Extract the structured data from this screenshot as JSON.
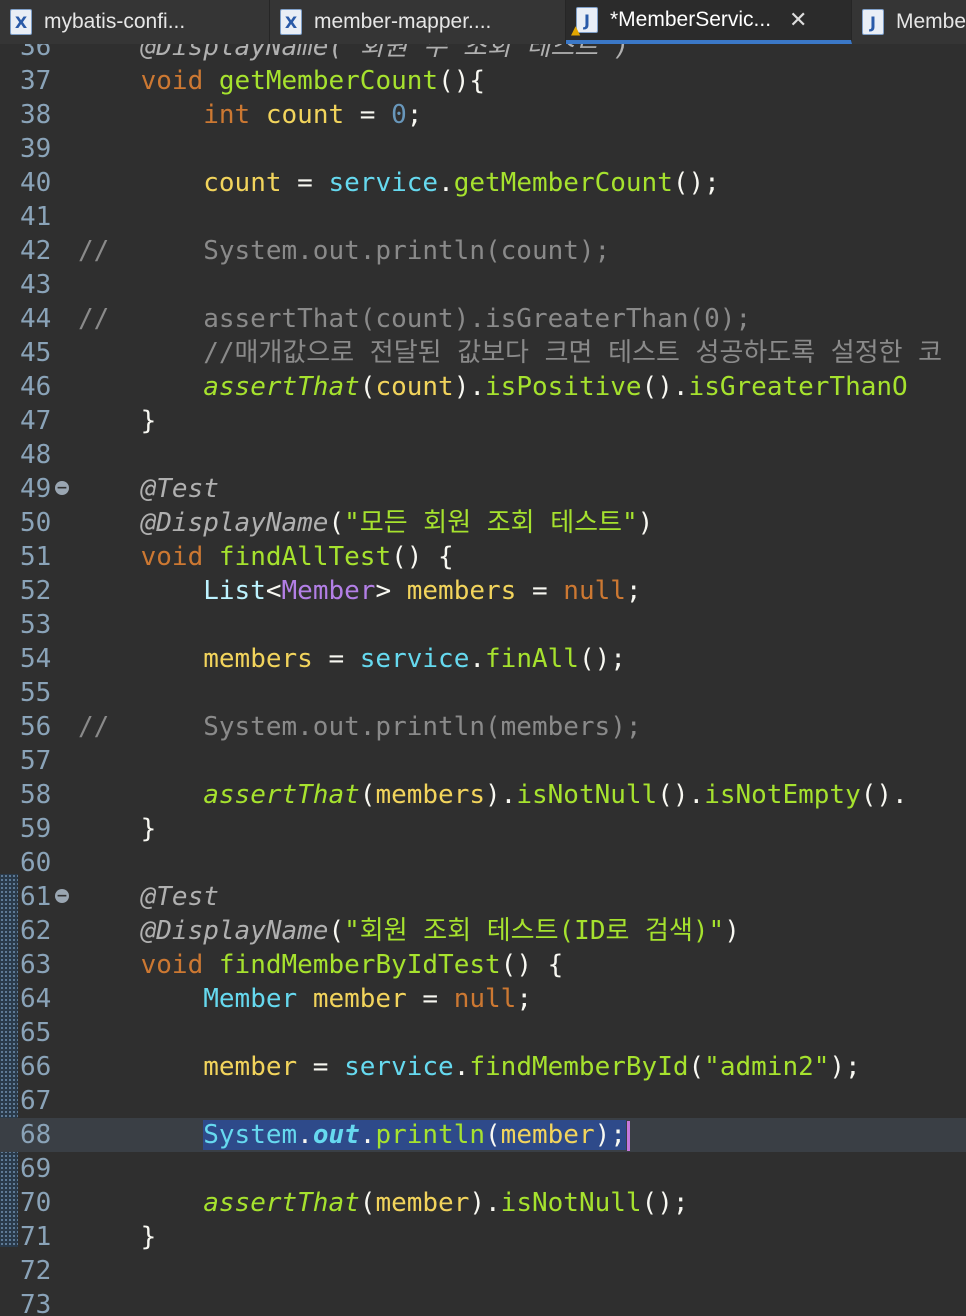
{
  "tabs": [
    {
      "label": "mybatis-confi...",
      "icon": "xml-file-icon",
      "active": false
    },
    {
      "label": "member-mapper....",
      "icon": "xml-file-icon",
      "active": false
    },
    {
      "label": "*MemberServic...",
      "icon": "java-file-warning-icon",
      "active": true
    },
    {
      "label": "Membe",
      "icon": "java-file-icon",
      "active": false
    }
  ],
  "editor": {
    "current_line": 68,
    "lines": [
      {
        "n": "36",
        "tokens": [
          {
            "t": "    ",
            "c": ""
          },
          {
            "t": "@DisplayName(\"회원 수 조회 테스트\")",
            "c": "ann"
          }
        ]
      },
      {
        "n": "37",
        "tokens": [
          {
            "t": "    ",
            "c": ""
          },
          {
            "t": "void",
            "c": "kw"
          },
          {
            "t": " ",
            "c": ""
          },
          {
            "t": "getMemberCount",
            "c": "method"
          },
          {
            "t": "(){",
            "c": "paren"
          }
        ]
      },
      {
        "n": "38",
        "tokens": [
          {
            "t": "        ",
            "c": ""
          },
          {
            "t": "int",
            "c": "kw"
          },
          {
            "t": " ",
            "c": ""
          },
          {
            "t": "count",
            "c": "var"
          },
          {
            "t": " = ",
            "c": "op"
          },
          {
            "t": "0",
            "c": "num"
          },
          {
            "t": ";",
            "c": "paren"
          }
        ]
      },
      {
        "n": "39",
        "tokens": []
      },
      {
        "n": "40",
        "tokens": [
          {
            "t": "        ",
            "c": ""
          },
          {
            "t": "count",
            "c": "var"
          },
          {
            "t": " = ",
            "c": "op"
          },
          {
            "t": "service",
            "c": "field"
          },
          {
            "t": ".",
            "c": "op"
          },
          {
            "t": "getMemberCount",
            "c": "method"
          },
          {
            "t": "();",
            "c": "paren"
          }
        ]
      },
      {
        "n": "41",
        "tokens": []
      },
      {
        "n": "42",
        "tokens": [
          {
            "t": "//      System.out.println(count);",
            "c": "comment"
          }
        ]
      },
      {
        "n": "43",
        "tokens": []
      },
      {
        "n": "44",
        "tokens": [
          {
            "t": "//      assertThat(count).isGreaterThan(0);",
            "c": "comment"
          }
        ]
      },
      {
        "n": "45",
        "tokens": [
          {
            "t": "        //매개값으로 전달된 값보다 크면 테스트 성공하도록 설정한 코",
            "c": "comment"
          }
        ]
      },
      {
        "n": "46",
        "tokens": [
          {
            "t": "        ",
            "c": ""
          },
          {
            "t": "assertThat",
            "c": "static"
          },
          {
            "t": "(",
            "c": "paren"
          },
          {
            "t": "count",
            "c": "var"
          },
          {
            "t": ").",
            "c": "paren"
          },
          {
            "t": "isPositive",
            "c": "method"
          },
          {
            "t": "().",
            "c": "paren"
          },
          {
            "t": "isGreaterThanO",
            "c": "method"
          }
        ]
      },
      {
        "n": "47",
        "tokens": [
          {
            "t": "    }",
            "c": "paren"
          }
        ]
      },
      {
        "n": "48",
        "tokens": []
      },
      {
        "n": "49",
        "fold": true,
        "tokens": [
          {
            "t": "    ",
            "c": ""
          },
          {
            "t": "@Test",
            "c": "ann"
          }
        ]
      },
      {
        "n": "50",
        "tokens": [
          {
            "t": "    ",
            "c": ""
          },
          {
            "t": "@DisplayName",
            "c": "ann"
          },
          {
            "t": "(",
            "c": "paren"
          },
          {
            "t": "\"모든 회원 조회 테스트\"",
            "c": "string"
          },
          {
            "t": ")",
            "c": "paren"
          }
        ]
      },
      {
        "n": "51",
        "tokens": [
          {
            "t": "    ",
            "c": ""
          },
          {
            "t": "void",
            "c": "kw"
          },
          {
            "t": " ",
            "c": ""
          },
          {
            "t": "findAllTest",
            "c": "method"
          },
          {
            "t": "() {",
            "c": "paren"
          }
        ]
      },
      {
        "n": "52",
        "tokens": [
          {
            "t": "        ",
            "c": ""
          },
          {
            "t": "List",
            "c": "type"
          },
          {
            "t": "<",
            "c": "op"
          },
          {
            "t": "Member",
            "c": "generic"
          },
          {
            "t": "> ",
            "c": "op"
          },
          {
            "t": "members",
            "c": "var"
          },
          {
            "t": " = ",
            "c": "op"
          },
          {
            "t": "null",
            "c": "kwnull"
          },
          {
            "t": ";",
            "c": "paren"
          }
        ]
      },
      {
        "n": "53",
        "tokens": []
      },
      {
        "n": "54",
        "tokens": [
          {
            "t": "        ",
            "c": ""
          },
          {
            "t": "members",
            "c": "var"
          },
          {
            "t": " = ",
            "c": "op"
          },
          {
            "t": "service",
            "c": "field"
          },
          {
            "t": ".",
            "c": "op"
          },
          {
            "t": "finAll",
            "c": "method"
          },
          {
            "t": "();",
            "c": "paren"
          }
        ]
      },
      {
        "n": "55",
        "tokens": []
      },
      {
        "n": "56",
        "tokens": [
          {
            "t": "//      System.out.println(members);",
            "c": "comment"
          }
        ]
      },
      {
        "n": "57",
        "tokens": []
      },
      {
        "n": "58",
        "tokens": [
          {
            "t": "        ",
            "c": ""
          },
          {
            "t": "assertThat",
            "c": "static"
          },
          {
            "t": "(",
            "c": "paren"
          },
          {
            "t": "members",
            "c": "var"
          },
          {
            "t": ").",
            "c": "paren"
          },
          {
            "t": "isNotNull",
            "c": "method"
          },
          {
            "t": "().",
            "c": "paren"
          },
          {
            "t": "isNotEmpty",
            "c": "method"
          },
          {
            "t": "().",
            "c": "paren"
          }
        ]
      },
      {
        "n": "59",
        "tokens": [
          {
            "t": "    }",
            "c": "paren"
          }
        ]
      },
      {
        "n": "60",
        "tokens": []
      },
      {
        "n": "61",
        "fold": true,
        "tokens": [
          {
            "t": "    ",
            "c": ""
          },
          {
            "t": "@Test",
            "c": "ann"
          }
        ]
      },
      {
        "n": "62",
        "tokens": [
          {
            "t": "    ",
            "c": ""
          },
          {
            "t": "@DisplayName",
            "c": "ann"
          },
          {
            "t": "(",
            "c": "paren"
          },
          {
            "t": "\"회원 조회 테스트(ID로 검색)\"",
            "c": "string"
          },
          {
            "t": ")",
            "c": "paren"
          }
        ]
      },
      {
        "n": "63",
        "tokens": [
          {
            "t": "    ",
            "c": ""
          },
          {
            "t": "void",
            "c": "kw"
          },
          {
            "t": " ",
            "c": ""
          },
          {
            "t": "findMemberByIdTest",
            "c": "method"
          },
          {
            "t": "() {",
            "c": "paren"
          }
        ]
      },
      {
        "n": "64",
        "tokens": [
          {
            "t": "        ",
            "c": ""
          },
          {
            "t": "Member",
            "c": "class"
          },
          {
            "t": " ",
            "c": ""
          },
          {
            "t": "member",
            "c": "var"
          },
          {
            "t": " = ",
            "c": "op"
          },
          {
            "t": "null",
            "c": "kwnull"
          },
          {
            "t": ";",
            "c": "paren"
          }
        ]
      },
      {
        "n": "65",
        "tokens": []
      },
      {
        "n": "66",
        "tokens": [
          {
            "t": "        ",
            "c": ""
          },
          {
            "t": "member",
            "c": "var"
          },
          {
            "t": " = ",
            "c": "op"
          },
          {
            "t": "service",
            "c": "field"
          },
          {
            "t": ".",
            "c": "op"
          },
          {
            "t": "findMemberById",
            "c": "method"
          },
          {
            "t": "(",
            "c": "paren"
          },
          {
            "t": "\"admin2\"",
            "c": "string"
          },
          {
            "t": ");",
            "c": "paren"
          }
        ]
      },
      {
        "n": "67",
        "tokens": []
      },
      {
        "n": "68",
        "selected": true,
        "tokens": [
          {
            "t": "        ",
            "c": ""
          },
          {
            "t": "System",
            "c": "field"
          },
          {
            "t": ".",
            "c": "op"
          },
          {
            "t": "out",
            "c": "staticfield"
          },
          {
            "t": ".",
            "c": "op"
          },
          {
            "t": "println",
            "c": "method"
          },
          {
            "t": "(",
            "c": "paren"
          },
          {
            "t": "member",
            "c": "var"
          },
          {
            "t": ");",
            "c": "paren"
          }
        ]
      },
      {
        "n": "69",
        "tokens": []
      },
      {
        "n": "70",
        "tokens": [
          {
            "t": "        ",
            "c": ""
          },
          {
            "t": "assertThat",
            "c": "static"
          },
          {
            "t": "(",
            "c": "paren"
          },
          {
            "t": "member",
            "c": "var"
          },
          {
            "t": ").",
            "c": "paren"
          },
          {
            "t": "isNotNull",
            "c": "method"
          },
          {
            "t": "();",
            "c": "paren"
          }
        ]
      },
      {
        "n": "71",
        "tokens": [
          {
            "t": "    }",
            "c": "paren"
          }
        ]
      },
      {
        "n": "72",
        "tokens": []
      },
      {
        "n": "73",
        "tokens": []
      }
    ]
  }
}
